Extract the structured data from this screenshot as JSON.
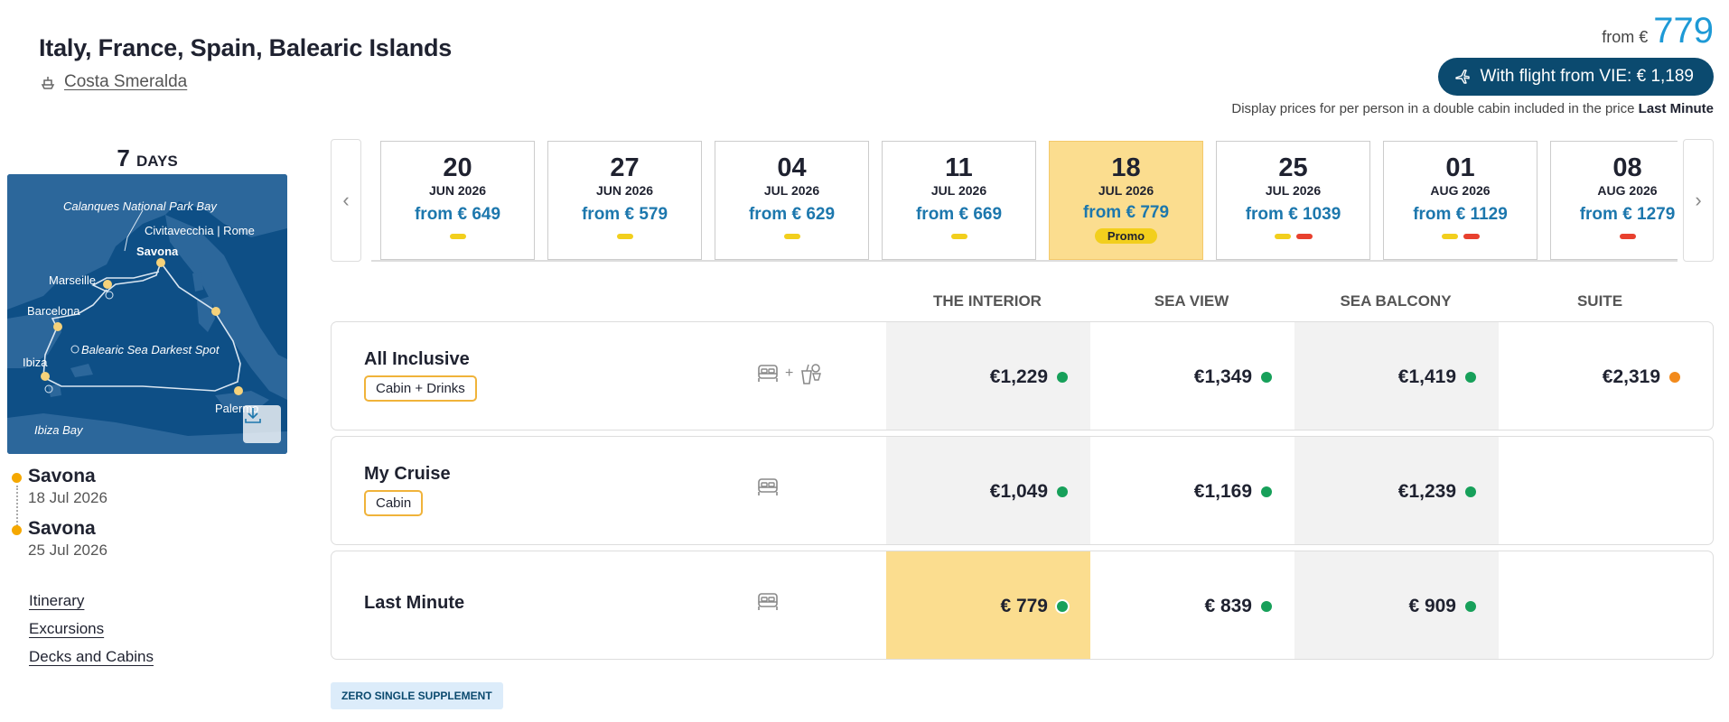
{
  "header": {
    "title": "Italy, France, Spain, Balearic Islands",
    "ship_name": "Costa Smeralda",
    "from_label": "from €",
    "from_value": "779",
    "flight_button": "With flight from VIE: € 1,189",
    "price_note": "Display prices for per person in a double cabin included in the price",
    "price_note_bold": "Last Minute"
  },
  "sidebar": {
    "days_number": "7",
    "days_unit": "DAYS",
    "map_labels": {
      "calanques": "Calanques National Park Bay",
      "civitavecchia": "Civitavecchia | Rome",
      "savona": "Savona",
      "marseille": "Marseille",
      "barcelona": "Barcelona",
      "balearic": "Balearic Sea Darkest Spot",
      "ibiza": "Ibiza",
      "palermo": "Palermo",
      "ibiza_bay": "Ibiza Bay"
    },
    "departure": {
      "port": "Savona",
      "date": "18 Jul 2026"
    },
    "arrival": {
      "port": "Savona",
      "date": "25 Jul 2026"
    },
    "links": [
      "Itinerary",
      "Excursions",
      "Decks and Cabins"
    ]
  },
  "dates": [
    {
      "day": "20",
      "month": "JUN 2026",
      "price": "from € 649",
      "bars": [
        "yellow"
      ],
      "selected": false
    },
    {
      "day": "27",
      "month": "JUN 2026",
      "price": "from € 579",
      "bars": [
        "yellow"
      ],
      "selected": false
    },
    {
      "day": "04",
      "month": "JUL 2026",
      "price": "from € 629",
      "bars": [
        "yellow"
      ],
      "selected": false
    },
    {
      "day": "11",
      "month": "JUL 2026",
      "price": "from € 669",
      "bars": [
        "yellow"
      ],
      "selected": false
    },
    {
      "day": "18",
      "month": "JUL 2026",
      "price": "from € 779",
      "bars": [],
      "selected": true,
      "promo": "Promo"
    },
    {
      "day": "25",
      "month": "JUL 2026",
      "price": "from € 1039",
      "bars": [
        "yellow",
        "red"
      ],
      "selected": false
    },
    {
      "day": "01",
      "month": "AUG 2026",
      "price": "from € 1129",
      "bars": [
        "yellow",
        "red"
      ],
      "selected": false
    },
    {
      "day": "08",
      "month": "AUG 2026",
      "price": "from € 1279",
      "bars": [
        "red"
      ],
      "selected": false
    }
  ],
  "table": {
    "columns": [
      "THE INTERIOR",
      "SEA VIEW",
      "SEA BALCONY",
      "SUITE"
    ],
    "rows": [
      {
        "name": "All Inclusive",
        "tag": "Cabin + Drinks",
        "icons": [
          "bed-icon",
          "plus",
          "drinks-icon"
        ],
        "plus": "+",
        "cells": [
          {
            "value": "€1,229",
            "status": "green"
          },
          {
            "value": "€1,349",
            "status": "green"
          },
          {
            "value": "€1,419",
            "status": "green"
          },
          {
            "value": "€2,319",
            "status": "orange"
          }
        ]
      },
      {
        "name": "My Cruise",
        "tag": "Cabin",
        "icons": [
          "bed-icon"
        ],
        "cells": [
          {
            "value": "€1,049",
            "status": "green"
          },
          {
            "value": "€1,169",
            "status": "green"
          },
          {
            "value": "€1,239",
            "status": "green"
          }
        ]
      },
      {
        "name": "Last Minute",
        "tag": "",
        "icons": [
          "bed-icon"
        ],
        "cells": [
          {
            "value": "€ 779",
            "status": "green",
            "highlight": true
          },
          {
            "value": "€ 839",
            "status": "green"
          },
          {
            "value": "€ 909",
            "status": "green"
          }
        ]
      }
    ]
  },
  "badge": "ZERO SINGLE SUPPLEMENT",
  "colors": {
    "accent_blue": "#1e9ad6",
    "navy": "#0b4a6f",
    "highlight_yellow": "#fbdd8f",
    "status_green": "#17a05a",
    "status_orange": "#f28a1c"
  }
}
